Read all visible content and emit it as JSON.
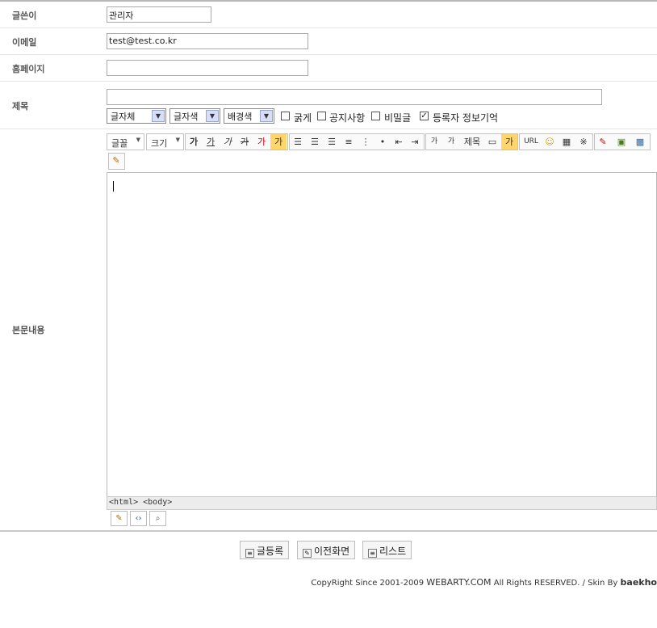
{
  "form": {
    "author_label": "글쓴이",
    "author_value": "관리자",
    "email_label": "이메일",
    "email_value": "test@test.co.kr",
    "homepage_label": "홈페이지",
    "homepage_value": "",
    "subject_label": "제목",
    "subject_value": "",
    "body_label": "본문내용"
  },
  "options": {
    "font_select": "글자체",
    "color_select": "글자색",
    "bgcolor_select": "배경색",
    "bold_label": "굵게",
    "notice_label": "공지사항",
    "secret_label": "비밀글",
    "remember_label": "등록자 정보기억"
  },
  "toolbar": {
    "font_dropdown": "글꼴",
    "size_dropdown": "크기",
    "bold": "가",
    "underline": "가",
    "italic": "가",
    "strike": "가",
    "forecolor": "가",
    "bgcolor": "가",
    "superscript": "가",
    "subscript": "가",
    "title_btn": "제목",
    "highlight": "가",
    "url": "URL",
    "special_char": "※"
  },
  "editor": {
    "status_path": "<html> <body>"
  },
  "buttons": {
    "submit": "글등록",
    "back": "이전화면",
    "list": "리스트"
  },
  "footer": {
    "copyright": "CopyRight Since 2001-2009",
    "brand": "WEBARTY.COM",
    "rights": "All Rights RESERVED. / Skin By",
    "skin_author": "baekho"
  }
}
